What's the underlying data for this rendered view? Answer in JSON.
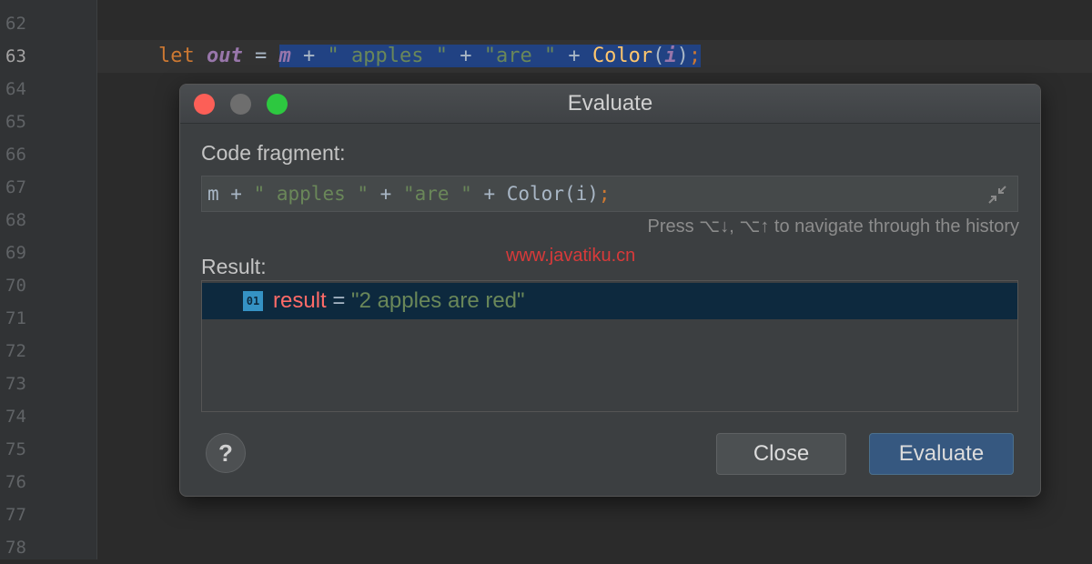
{
  "editor": {
    "line_numbers": [
      "62",
      "63",
      "64",
      "65",
      "66",
      "67",
      "68",
      "69",
      "70",
      "71",
      "72",
      "73",
      "74",
      "75",
      "76",
      "77",
      "78"
    ],
    "current_line": "63",
    "code_line": {
      "keyword": "let",
      "var_name": "out",
      "assign": " = ",
      "t_m": "m",
      "t_op1": " + ",
      "t_str1": "\" apples \"",
      "t_op2": " + ",
      "t_str2": "\"are \"",
      "t_op3": " + ",
      "t_fn": "Color",
      "t_lp": "(",
      "t_i": "i",
      "t_rp": ")",
      "t_semi": ";"
    }
  },
  "dialog": {
    "title": "Evaluate",
    "code_fragment_label": "Code fragment:",
    "fragment": {
      "f_m": "m",
      "f_op1": " + ",
      "f_str1": "\" apples \"",
      "f_op2": " + ",
      "f_str2": "\"are \"",
      "f_op3": " + Color(i)",
      "f_semi": ";"
    },
    "history_hint": "Press ⌥↓, ⌥↑ to navigate through the history",
    "watermark": "www.javatiku.cn",
    "result_label": "Result:",
    "result": {
      "icon_text": "01",
      "name": "result",
      "eq": " = ",
      "value": "\"2 apples are red\""
    },
    "help_label": "?",
    "close_label": "Close",
    "evaluate_label": "Evaluate"
  },
  "colors": {
    "editor_bg": "#2b2b2b",
    "selection": "#214283",
    "keyword": "#cc7832",
    "string": "#6a8759",
    "function": "#ffc66d",
    "variable": "#9876aa",
    "result_name": "#ff6b68",
    "primary_button": "#365880"
  }
}
